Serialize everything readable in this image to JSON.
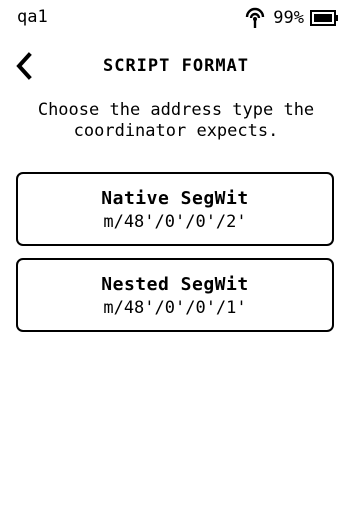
{
  "status_bar": {
    "device_name": "qa1",
    "battery_percent": "99%",
    "icons": [
      "nfc-icon",
      "battery-icon"
    ]
  },
  "header": {
    "title": "SCRIPT FORMAT",
    "back_icon": "chevron-left-icon"
  },
  "instruction": {
    "line1": "Choose the address type the",
    "line2": "coordinator expects."
  },
  "options": [
    {
      "title": "Native SegWit",
      "path": "m/48'/0'/0'/2'"
    },
    {
      "title": "Nested SegWit",
      "path": "m/48'/0'/0'/1'"
    }
  ],
  "colors": {
    "background": "#ffffff",
    "foreground": "#000000"
  }
}
